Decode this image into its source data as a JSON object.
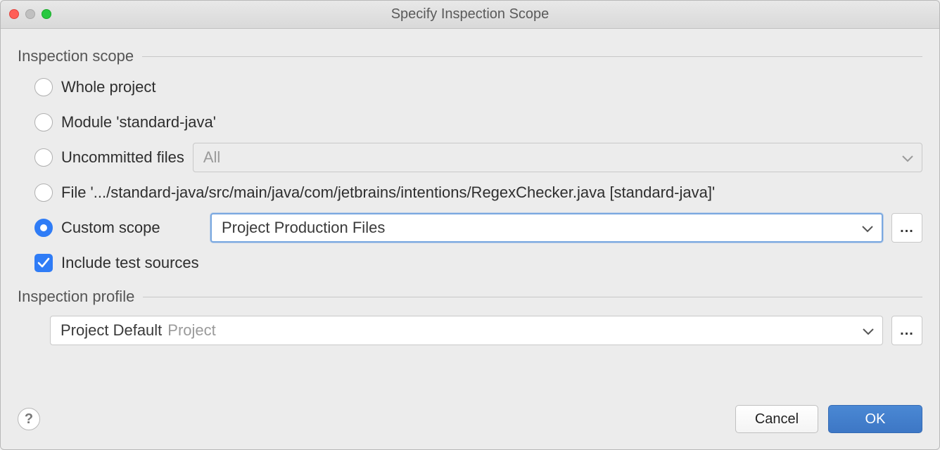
{
  "window": {
    "title": "Specify Inspection Scope"
  },
  "section1": {
    "title": "Inspection scope"
  },
  "options": {
    "whole_project": "Whole project",
    "module": "Module 'standard-java'",
    "uncommitted": "Uncommitted files",
    "uncommitted_value": "All",
    "file": "File '.../standard-java/src/main/java/com/jetbrains/intentions/RegexChecker.java [standard-java]'",
    "custom_scope": "Custom scope",
    "custom_scope_value": "Project Production Files",
    "include_tests": "Include test sources",
    "more": "..."
  },
  "section2": {
    "title": "Inspection profile"
  },
  "profile": {
    "value": "Project Default",
    "secondary": "Project",
    "more": "..."
  },
  "footer": {
    "help": "?",
    "cancel": "Cancel",
    "ok": "OK"
  }
}
